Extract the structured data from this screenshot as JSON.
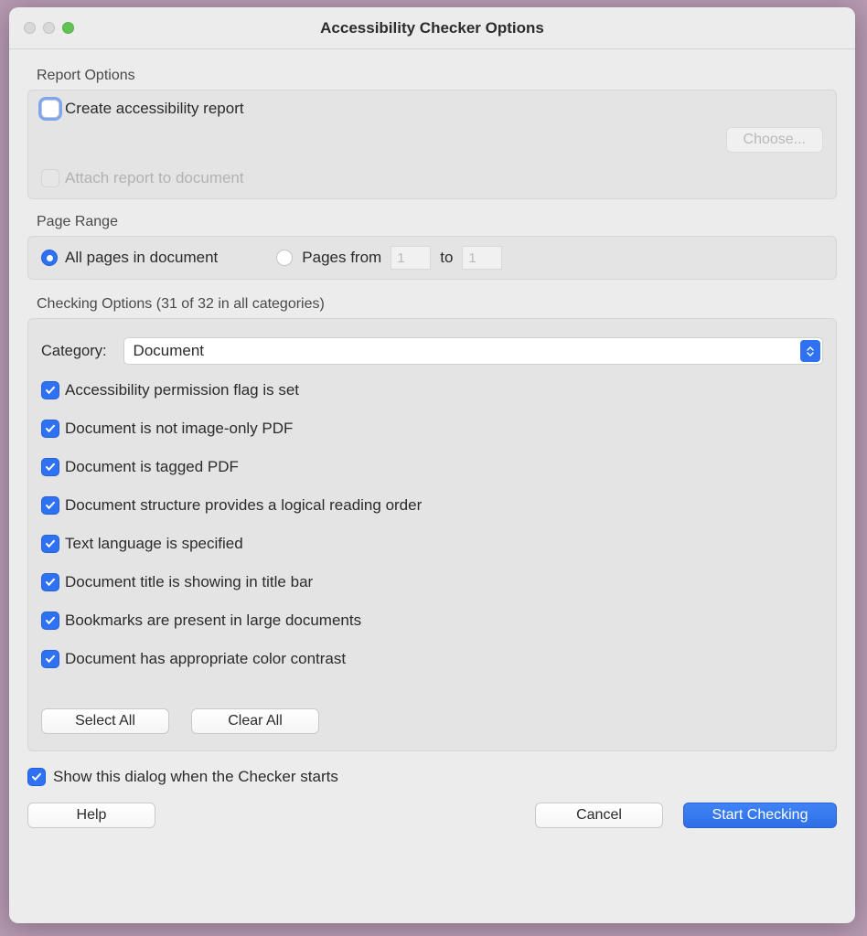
{
  "title": "Accessibility Checker Options",
  "report": {
    "section_label": "Report Options",
    "create_label": "Create accessibility report",
    "create_checked": false,
    "choose_label": "Choose...",
    "attach_label": "Attach report to document"
  },
  "page_range": {
    "section_label": "Page Range",
    "all_label": "All pages in document",
    "pages_from_label": "Pages from",
    "to_label": "to",
    "from_value": "1",
    "to_value": "1"
  },
  "checking": {
    "section_label": "Checking Options (31 of 32 in all categories)",
    "category_label": "Category:",
    "category_value": "Document",
    "items": [
      "Accessibility permission flag is set",
      "Document is not image-only PDF",
      "Document is tagged PDF",
      "Document structure provides a logical reading order",
      "Text language is specified",
      "Document title is showing in title bar",
      "Bookmarks are present in large documents",
      "Document has appropriate color contrast"
    ],
    "select_all_label": "Select All",
    "clear_all_label": "Clear All"
  },
  "show_dialog_label": "Show this dialog when the Checker starts",
  "help_label": "Help",
  "cancel_label": "Cancel",
  "start_label": "Start Checking"
}
